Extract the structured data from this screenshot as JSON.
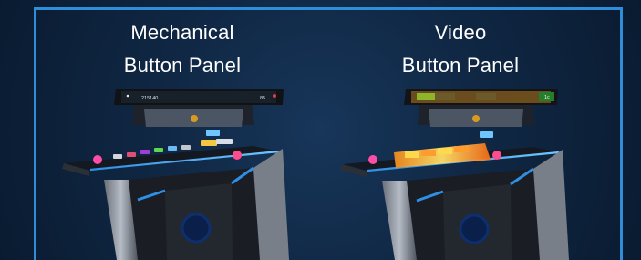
{
  "panels": [
    {
      "line1": "Mechanical",
      "line2": "Button Panel",
      "screen_text_1": "215140",
      "screen_text_2": "85"
    },
    {
      "line1": "Video",
      "line2": "Button Panel",
      "screen_text_1": "1c"
    }
  ],
  "colors": {
    "frame": "#2e8ed8",
    "background": "#102845",
    "accent": "#2e8ed8"
  }
}
